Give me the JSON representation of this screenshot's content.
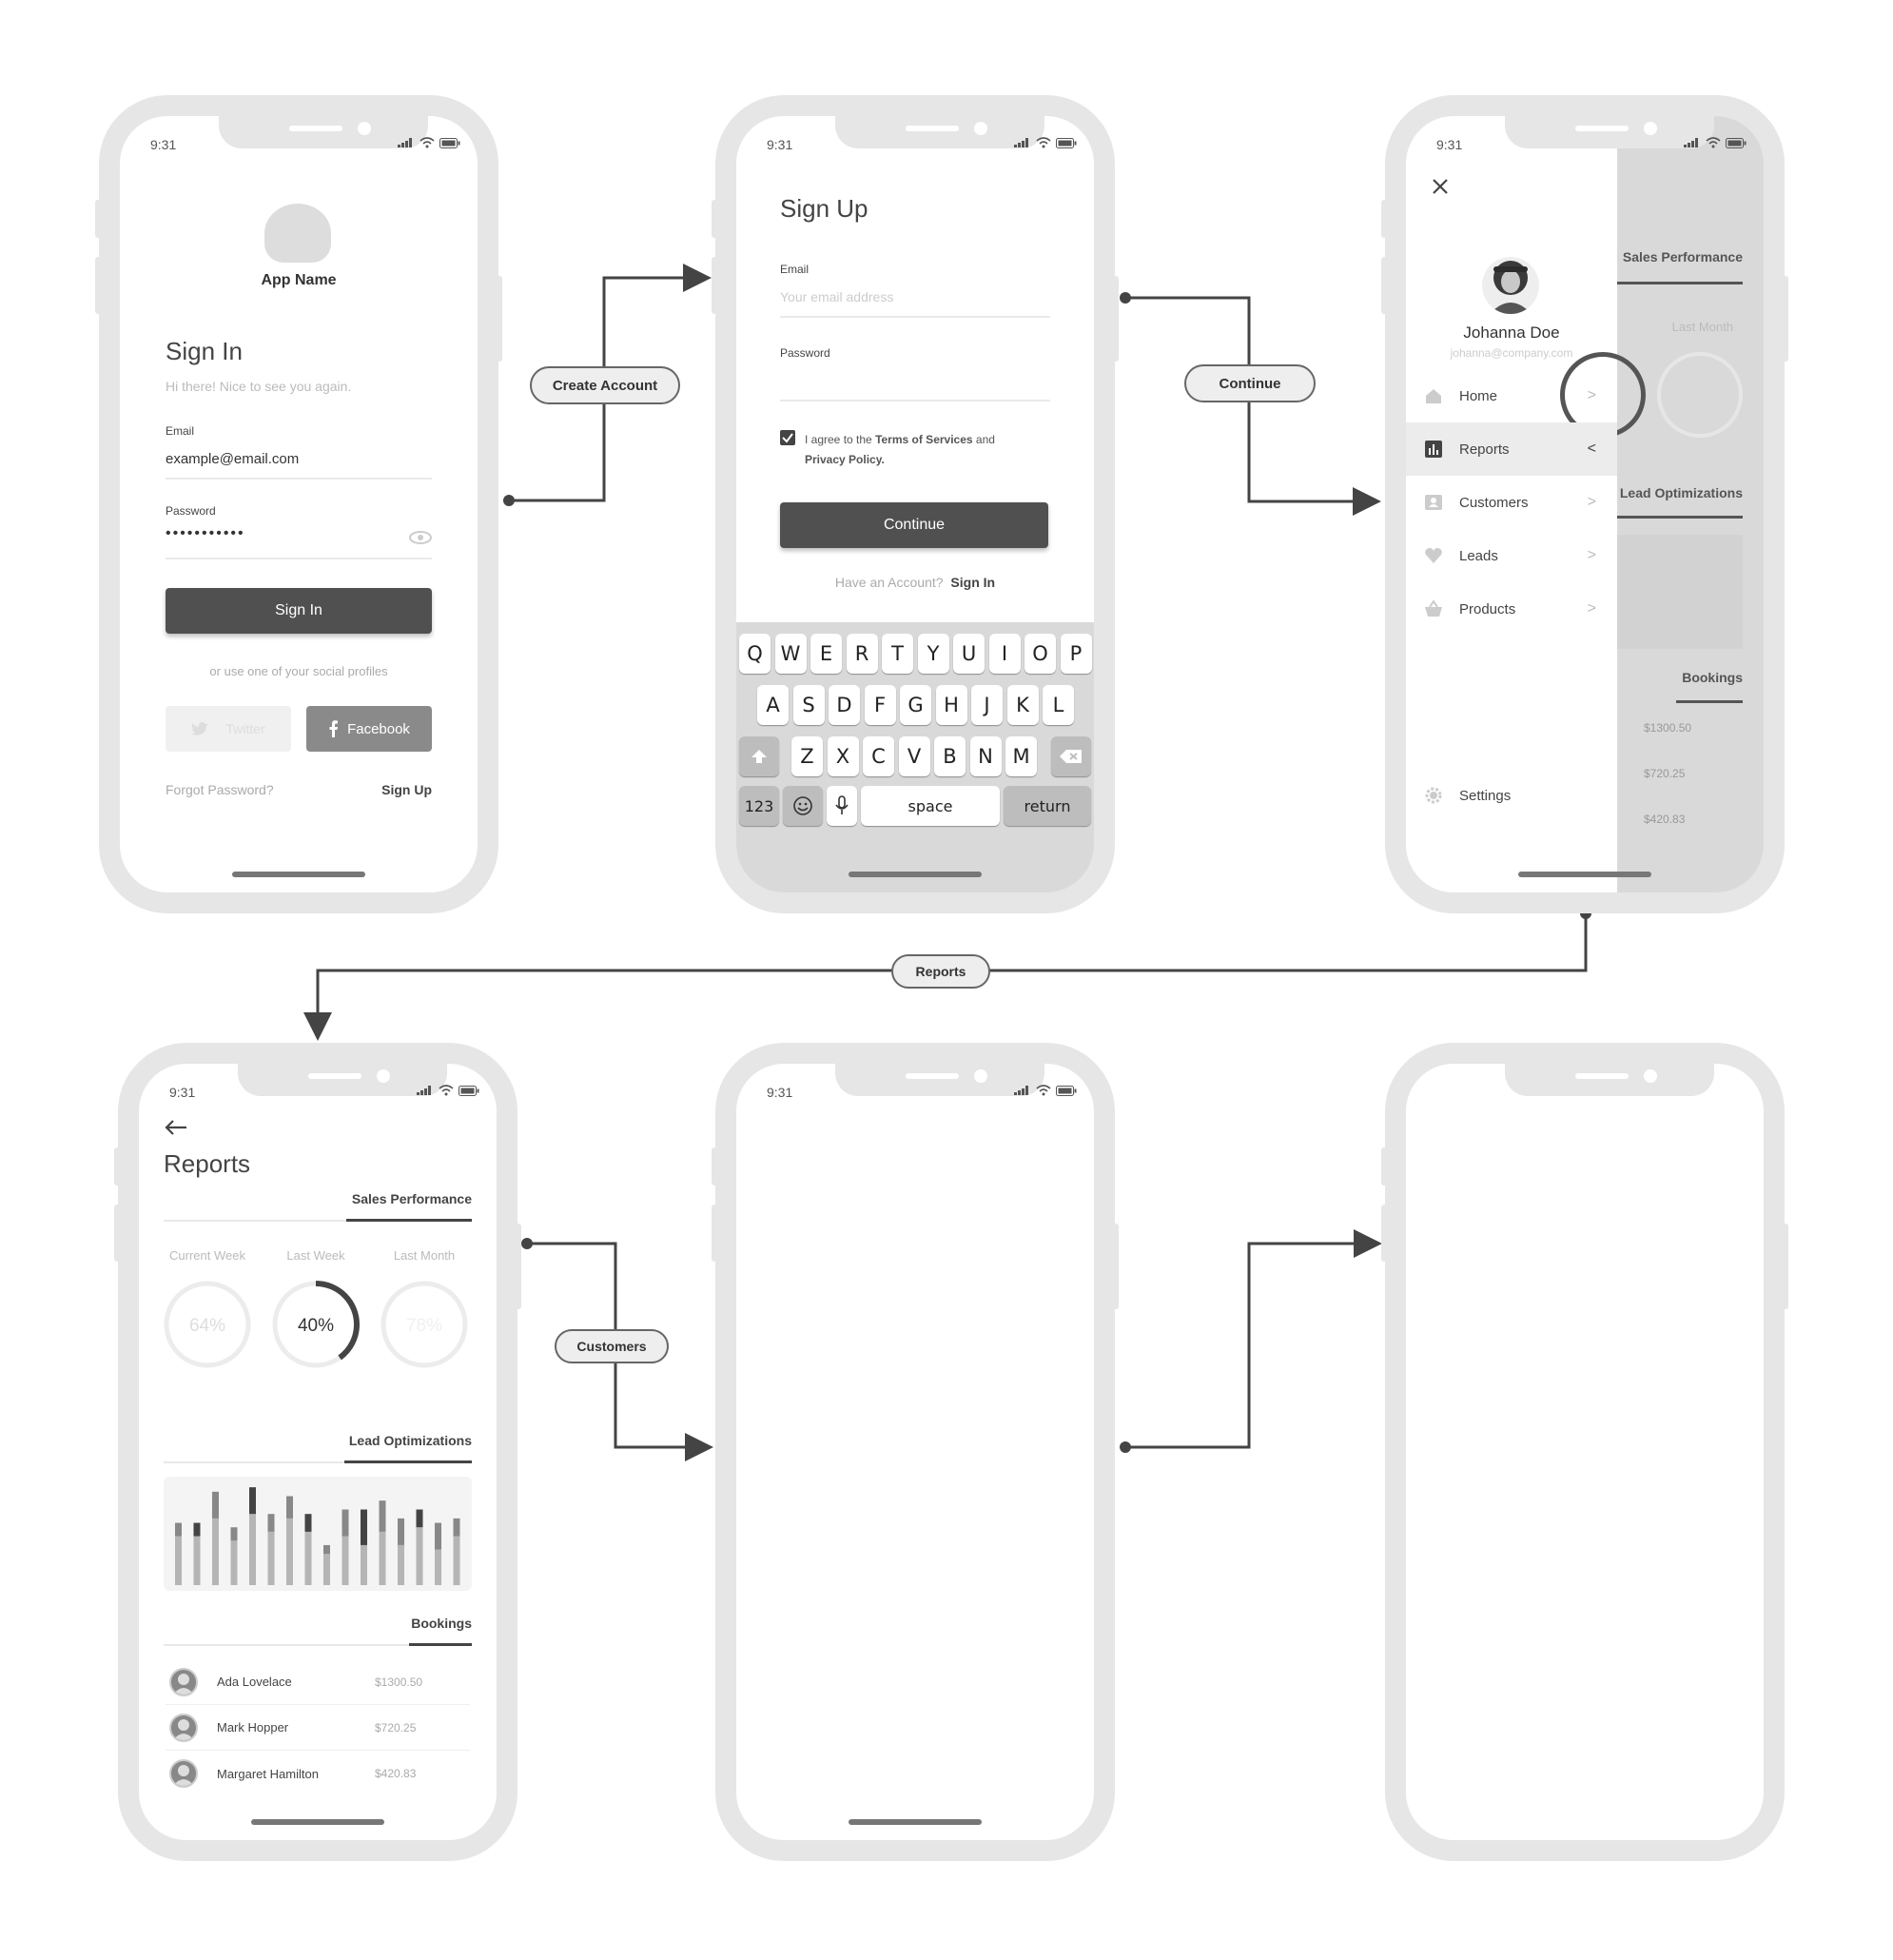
{
  "connectors": {
    "create_account": "Create Account",
    "continue": "Continue",
    "reports": "Reports",
    "customers": "Customers"
  },
  "signin": {
    "time": "9:31",
    "app_name": "App Name",
    "title": "Sign In",
    "subtitle": "Hi there! Nice to see you again.",
    "email_label": "Email",
    "email_value": "example@email.com",
    "password_label": "Password",
    "password_value": "•••••••••••",
    "sign_in_button": "Sign In",
    "social_hint": "or use one of your social profiles",
    "twitter": "Twitter",
    "facebook": "Facebook",
    "forgot": "Forgot Password?",
    "sign_up": "Sign Up"
  },
  "signup": {
    "time": "9:31",
    "title": "Sign Up",
    "email_label": "Email",
    "email_placeholder": "Your email address",
    "password_label": "Password",
    "agree_prefix": "I agree to the ",
    "terms": "Terms of Services",
    "agree_and": " and",
    "privacy": "Privacy Policy.",
    "continue_button": "Continue",
    "have_account": "Have an Account?",
    "sign_in": "Sign In",
    "keyboard": {
      "row1": [
        "Q",
        "W",
        "E",
        "R",
        "T",
        "Y",
        "U",
        "I",
        "O",
        "P"
      ],
      "row2": [
        "A",
        "S",
        "D",
        "F",
        "G",
        "H",
        "J",
        "K",
        "L"
      ],
      "row3": [
        "Z",
        "X",
        "C",
        "V",
        "B",
        "N",
        "M"
      ],
      "num": "123",
      "space": "space",
      "return": "return"
    }
  },
  "menu": {
    "time": "9:31",
    "user_name": "Johanna Doe",
    "user_email": "johanna@company.com",
    "items": [
      {
        "label": "Home",
        "icon": "home-icon",
        "chevron": ">"
      },
      {
        "label": "Reports",
        "icon": "bar-chart-icon",
        "chevron": "<"
      },
      {
        "label": "Customers",
        "icon": "contact-card-icon",
        "chevron": ">"
      },
      {
        "label": "Leads",
        "icon": "heart-icon",
        "chevron": ">"
      },
      {
        "label": "Products",
        "icon": "basket-icon",
        "chevron": ">"
      }
    ],
    "settings": "Settings",
    "behind": {
      "sales_performance": "Sales Performance",
      "last_month": "Last Month",
      "lead_optimizations": "Lead Optimizations",
      "bookings": "Bookings",
      "values": [
        "$1300.50",
        "$720.25",
        "$420.83"
      ]
    }
  },
  "reports": {
    "time": "9:31",
    "title": "Reports",
    "sales_tab": "Sales Performance",
    "periods": [
      {
        "label": "Current Week",
        "value": "64%",
        "progress": 0.64
      },
      {
        "label": "Last Week",
        "value": "40%",
        "progress": 0.4
      },
      {
        "label": "Last Month",
        "value": "78%",
        "progress": 0.78
      }
    ],
    "lead_tab": "Lead Optimizations",
    "bars_light": [
      0.55,
      0.55,
      0.75,
      0.5,
      0.8,
      0.6,
      0.75,
      0.6,
      0.35,
      0.55,
      0.45,
      0.6,
      0.45,
      0.65,
      0.4,
      0.55
    ],
    "bars_dark": [
      0.15,
      0.15,
      0.3,
      0.15,
      0.3,
      0.2,
      0.25,
      0.2,
      0.1,
      0.3,
      0.4,
      0.35,
      0.3,
      0.2,
      0.3,
      0.2
    ],
    "bookings_tab": "Bookings",
    "bookings": [
      {
        "name": "Ada Lovelace",
        "value": "$1300.50"
      },
      {
        "name": "Mark Hopper",
        "value": "$720.25"
      },
      {
        "name": "Margaret Hamilton",
        "value": "$420.83"
      }
    ]
  },
  "blank1": {
    "time": "9:31"
  }
}
